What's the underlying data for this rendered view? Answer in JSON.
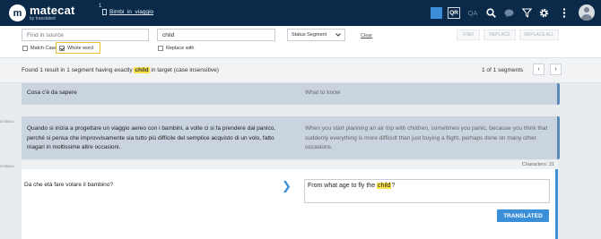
{
  "topbar": {
    "logo_mark": "m",
    "logo_name": "matecat",
    "logo_sub": "by translated",
    "project_count": "1",
    "project_name": "Bimbi_in_viaggio",
    "qr": "QR",
    "qa": "QA"
  },
  "search": {
    "source_placeholder": "Find in source",
    "target_value": "child",
    "status_select": "Status Segment",
    "clear": "Clear",
    "match_case": "Match Case",
    "whole_word": "Whole word",
    "replace_with": "Replace with",
    "find": "FIND",
    "replace": "REPLACE",
    "replace_all": "REPLACE ALL"
  },
  "results": {
    "prefix": "Found 1 result in 1 segment having exactly",
    "term": "child",
    "suffix": "in target (case insensitive)",
    "count": "1 of 1 segments"
  },
  "segments": [
    {
      "source": "Cosa c'è da sapere",
      "target": "What to know"
    },
    {
      "id": "5786644",
      "source": "Quando si inizia a progettare un viaggio aereo con i bambini, a volte ci si fa prendere dal panico, perché si pensa che improvvisamente sia tutto più difficile del semplice acquisto di un volo, fatto magari in moltissime altre occasioni.",
      "target": "When you start planning an air trip with children, sometimes you panic, because you think that suddenly everything is more difficult than just buying a flight, perhaps done on many other occasions."
    }
  ],
  "active": {
    "id": "5786645",
    "characters": "Characters: 31",
    "source": "Da che età fare volare il bambino?",
    "target_before": "From what age to fly the",
    "target_term": "child",
    "target_after": "?",
    "translated_label": "TRANSLATED"
  },
  "colors": {
    "accent": "#3b8ed8",
    "topbar": "#0b2a4a",
    "highlight": "#fbe34a"
  }
}
